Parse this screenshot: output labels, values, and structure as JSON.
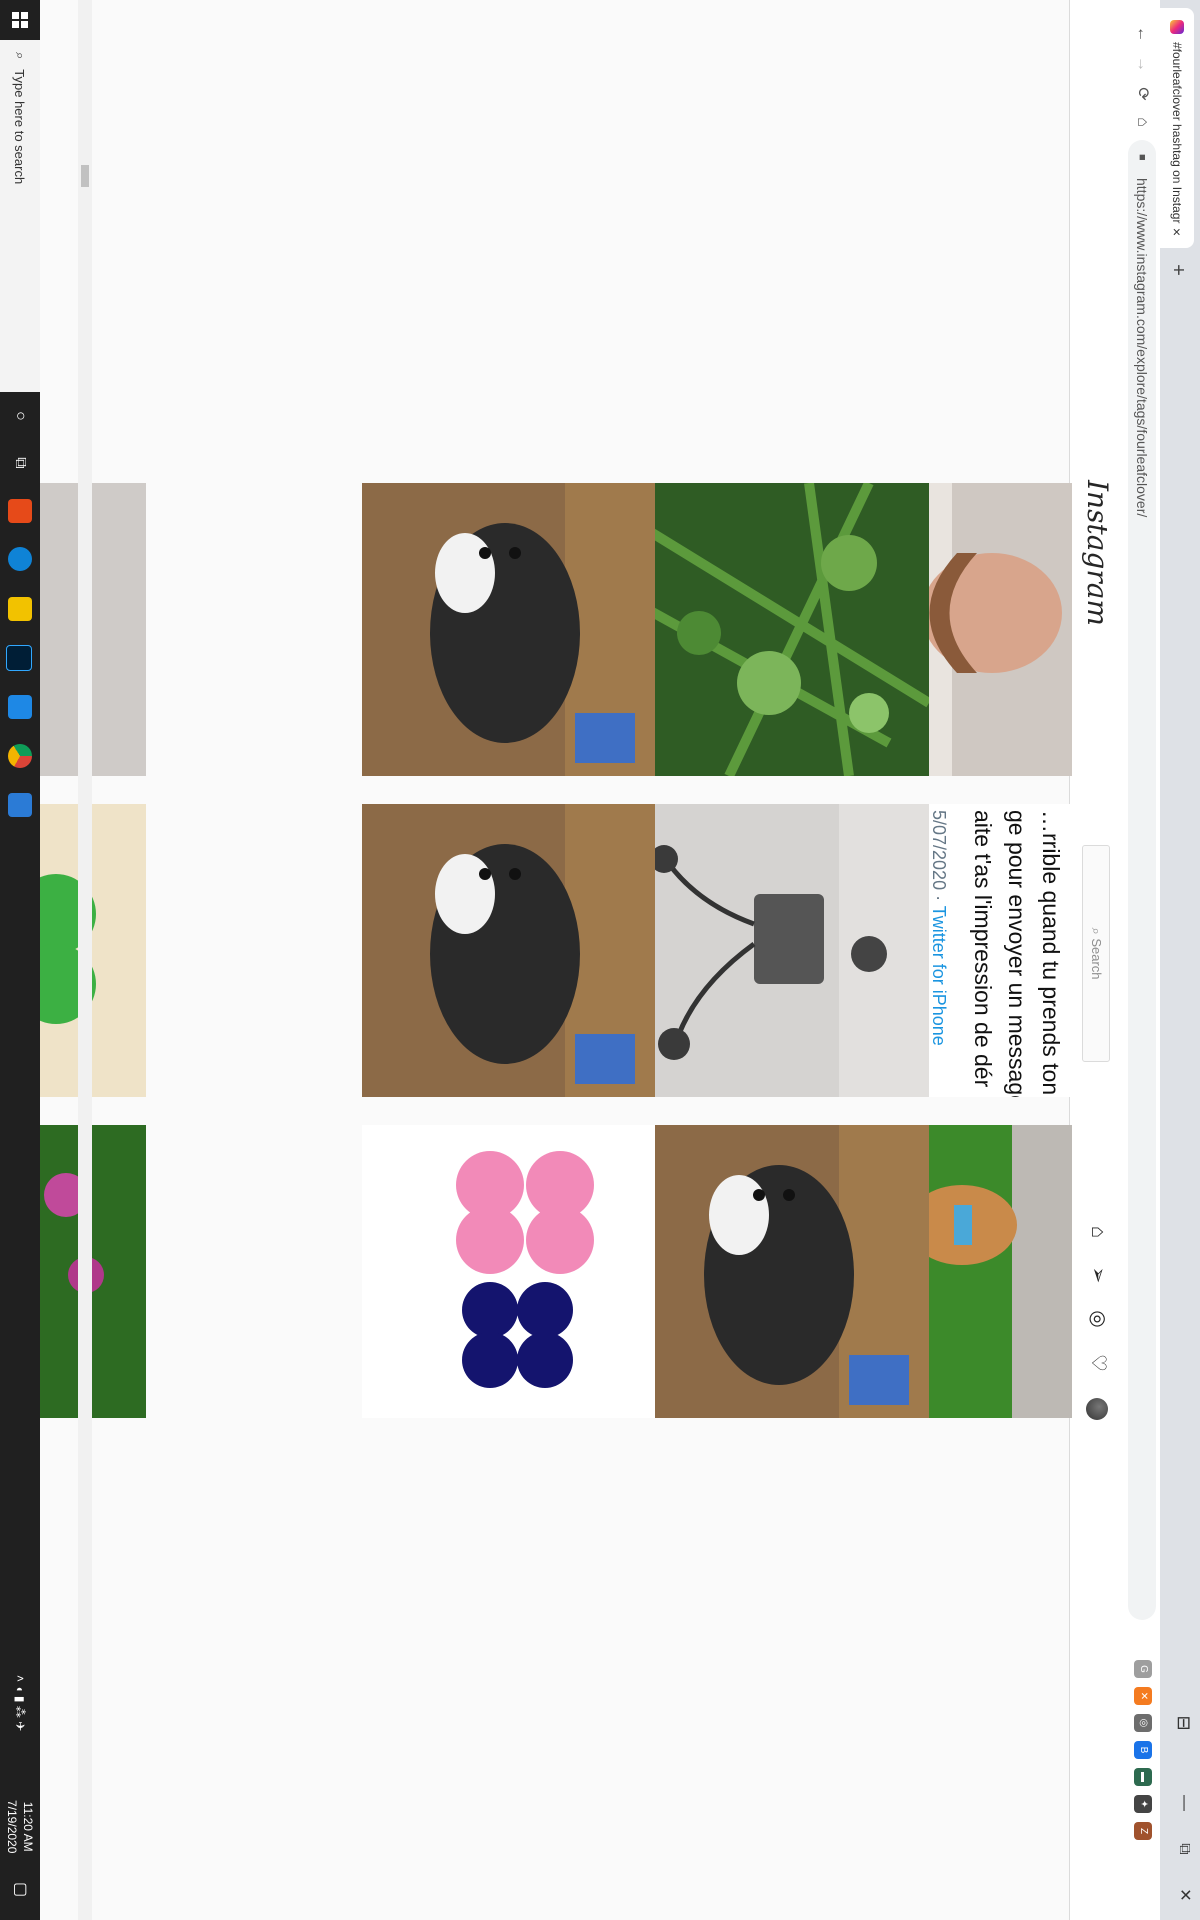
{
  "browser": {
    "tab_title": "#fourleafclover hashtag on Instagram",
    "tab_close": "×",
    "new_tab": "+",
    "url": "https://www.instagram.com/explore/tags/fourleafclover/",
    "window_minimize": "—",
    "window_maximize": "⧉",
    "window_close": "✕",
    "nav_back": "←",
    "nav_forward": "→",
    "nav_reload": "⟳",
    "nav_home": "⌂",
    "extensions": [
      "G",
      "✕",
      "◎",
      "B",
      "▬",
      "✦",
      "Z"
    ],
    "extension_colors": [
      "#9e9e9e",
      "#f47b20",
      "#6d6d6d",
      "#1a73e8",
      "#2d6a4f",
      "#444444",
      "#a0522d"
    ]
  },
  "instagram": {
    "logo": "Instagram",
    "search_placeholder": "Search",
    "nav_icons": [
      "home-icon",
      "direct-icon",
      "explore-icon",
      "activity-icon",
      "profile-avatar"
    ]
  },
  "grid": {
    "tweet_card": {
      "line1": "…rrible quand tu prends ton",
      "line2": "ge pour envoyer un message",
      "line3": "aite t'as l'impression de dér",
      "meta_prefix": "5/07/2020 · ",
      "meta_link": "Twitter for iPhone"
    },
    "tiles": [
      {
        "kind": "selfie",
        "desc": "man in green and white jersey"
      },
      {
        "kind": "clover",
        "desc": "clover leaves with raindrops"
      },
      {
        "kind": "kitten",
        "desc": "kitten on table"
      },
      {
        "kind": "gray",
        "desc": "gray surface"
      },
      {
        "kind": "tweet"
      },
      {
        "kind": "shadow",
        "desc": "shadow of four-leaf clover plant pot"
      },
      {
        "kind": "kitten"
      },
      {
        "kind": "charm",
        "desc": "green four-leaf clover charm necklace"
      },
      {
        "kind": "dog",
        "desc": "dog in grass"
      },
      {
        "kind": "kitten"
      },
      {
        "kind": "molds",
        "desc": "pink and blue glitter clover molds"
      },
      {
        "kind": "flowers",
        "desc": "purple clover flowers"
      }
    ]
  },
  "taskbar": {
    "search_placeholder": "Type here to search",
    "time": "11:20 AM",
    "date": "7/19/2020"
  }
}
